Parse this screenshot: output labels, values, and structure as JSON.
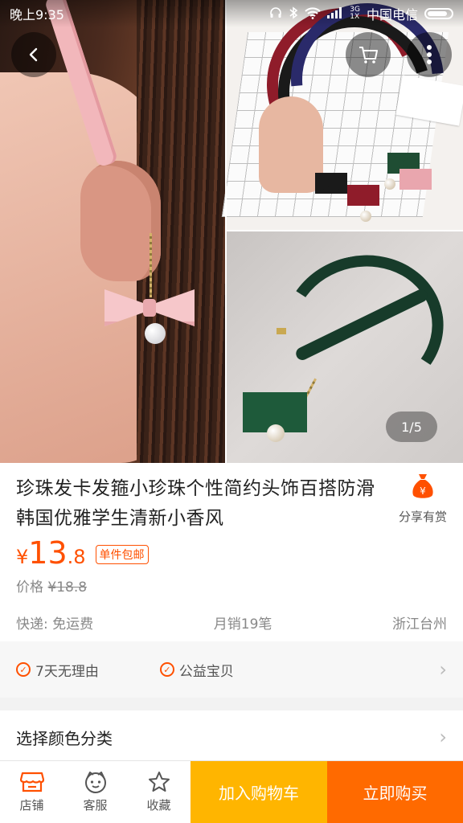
{
  "status_bar": {
    "time": "晚上9:35",
    "net_type_top": "3G",
    "net_type_bottom": "1X",
    "carrier": "中国电信",
    "battery_level": 0.85
  },
  "gallery": {
    "page_indicator": "1/5",
    "buttons": [
      "back-icon",
      "cart-icon",
      "more-vertical-icon"
    ]
  },
  "product": {
    "title": "珍珠发卡发箍小珍珠个性简约头饰百搭防滑韩国优雅学生清新小香风",
    "share_label": "分享有赏",
    "price_currency": "¥",
    "price_int": "13",
    "price_dec": ".8",
    "free_shipping_tag": "单件包邮",
    "orig_price_label": "价格",
    "orig_price": "¥18.8",
    "shipping": "快递: 免运费",
    "monthly_sales": "月销19笔",
    "location": "浙江台州"
  },
  "guarantees": [
    "7天无理由",
    "公益宝贝"
  ],
  "select_label": "选择颜色分类",
  "bottom_bar": {
    "tabs": [
      "店铺",
      "客服",
      "收藏"
    ],
    "add_cart": "加入购物车",
    "buy_now": "立即购买"
  },
  "colors": {
    "accent": "#ff5000",
    "add_cart_bg": "#ffb500",
    "buy_now_bg": "#ff6a00"
  }
}
